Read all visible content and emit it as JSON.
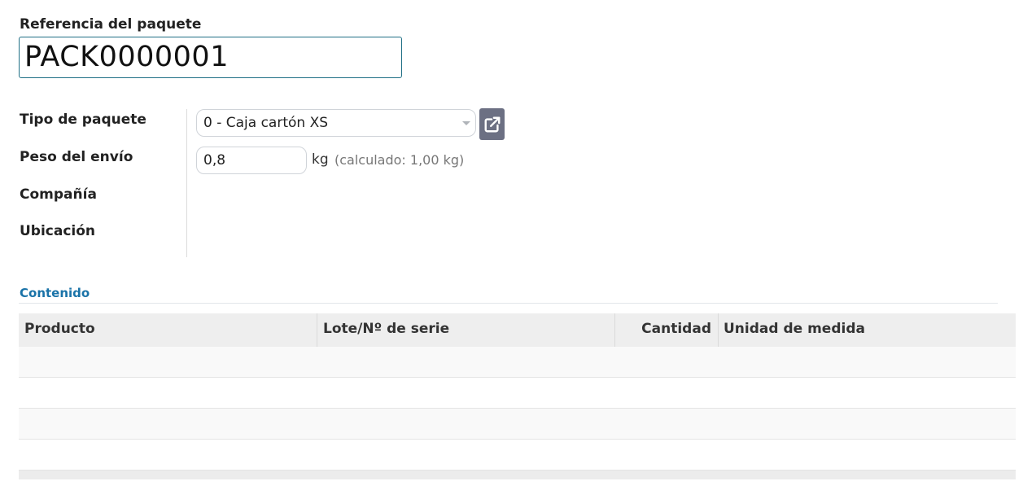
{
  "header": {
    "label": "Referencia del paquete",
    "value": "PACK0000001"
  },
  "fields": {
    "package_type": {
      "label": "Tipo de paquete",
      "value": "0 - Caja cartón XS"
    },
    "shipping_weight": {
      "label": "Peso del envío",
      "value": "0,8",
      "unit": "kg",
      "computed": "(calculado: 1,00 kg)"
    },
    "company": {
      "label": "Compañía"
    },
    "location": {
      "label": "Ubicación"
    }
  },
  "tabs": [
    {
      "label": "Contenido"
    }
  ],
  "table": {
    "columns": [
      "Producto",
      "Lote/Nº de serie",
      "Cantidad",
      "Unidad de medida"
    ],
    "rows": []
  },
  "icons": {
    "external_link": "external-link-icon",
    "dropdown": "caret-down-icon"
  },
  "colors": {
    "accent": "#1a73a8",
    "input_focus_border": "#1f6f85",
    "button_bg": "#6c7083"
  }
}
